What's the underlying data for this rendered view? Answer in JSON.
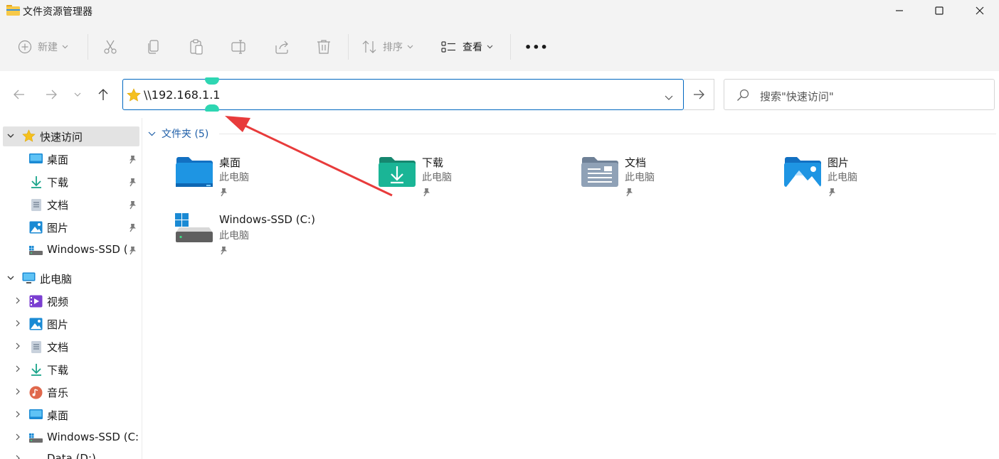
{
  "window": {
    "title": "文件资源管理器"
  },
  "toolbar": {
    "new_label": "新建",
    "sort_label": "排序",
    "view_label": "查看",
    "more_label": "•••"
  },
  "address": {
    "path": "\\\\192.168.1.1"
  },
  "search": {
    "placeholder": "搜索\"快速访问\""
  },
  "sidebar": {
    "quick_access": {
      "label": "快速访问",
      "items": [
        {
          "label": "桌面",
          "icon": "desktop-icon"
        },
        {
          "label": "下载",
          "icon": "download-icon"
        },
        {
          "label": "文档",
          "icon": "document-icon"
        },
        {
          "label": "图片",
          "icon": "pictures-icon"
        },
        {
          "label": "Windows-SSD (",
          "icon": "drive-icon"
        }
      ]
    },
    "this_pc": {
      "label": "此电脑",
      "items": [
        {
          "label": "视频",
          "icon": "videos-icon"
        },
        {
          "label": "图片",
          "icon": "pictures-icon"
        },
        {
          "label": "文档",
          "icon": "document-icon"
        },
        {
          "label": "下载",
          "icon": "download-icon"
        },
        {
          "label": "音乐",
          "icon": "music-icon"
        },
        {
          "label": "桌面",
          "icon": "desktop-icon"
        },
        {
          "label": "Windows-SSD (C:)",
          "icon": "drive-icon"
        },
        {
          "label": "Data (D:)",
          "icon": "drive-icon"
        }
      ]
    }
  },
  "content": {
    "group_label": "文件夹 (5)",
    "tiles": [
      {
        "name": "桌面",
        "sub": "此电脑",
        "icon": "desktop-folder-icon"
      },
      {
        "name": "下载",
        "sub": "此电脑",
        "icon": "downloads-folder-icon"
      },
      {
        "name": "文档",
        "sub": "此电脑",
        "icon": "documents-folder-icon"
      },
      {
        "name": "图片",
        "sub": "此电脑",
        "icon": "pictures-folder-icon"
      },
      {
        "name": "Windows-SSD (C:)",
        "sub": "此电脑",
        "icon": "drive-icon"
      }
    ]
  },
  "colors": {
    "accent": "#0067c0",
    "folder_blue": "#1a8ad4",
    "download_green": "#1aa58a",
    "annotation_red": "#e83b3b",
    "handle_teal": "#2ed6b2"
  }
}
